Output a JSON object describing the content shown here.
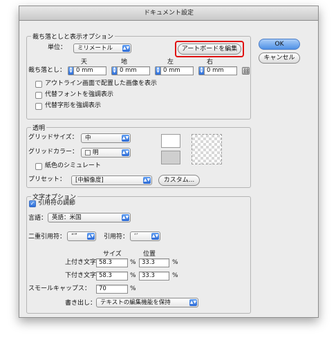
{
  "window": {
    "title": "ドキュメント設定"
  },
  "buttons": {
    "ok": "OK",
    "cancel": "キャンセル"
  },
  "bleed": {
    "legend": "裁ち落としと表示オプション",
    "unit_label": "単位：",
    "unit_value": "ミリメートル",
    "artboard_button": "アートボードを編集",
    "col_top": "天",
    "col_bottom": "地",
    "col_left": "左",
    "col_right": "右",
    "bleed_label": "裁ち落とし：",
    "top": "0 mm",
    "bottom": "0 mm",
    "left": "0 mm",
    "right": "0 mm",
    "cb_outline": "アウトライン画面で配置した画像を表示",
    "cb_font": "代替フォントを強調表示",
    "cb_glyph": "代替字形を強調表示"
  },
  "transparency": {
    "legend": "透明",
    "grid_size_label": "グリッドサイズ：",
    "grid_size_value": "中",
    "grid_color_label": "グリッドカラー：",
    "grid_color_value": "明",
    "cb_paper": "紙色のシミュレート",
    "preset_label": "プリセット：",
    "preset_value": "[中解像度]",
    "custom_button": "カスタム..."
  },
  "text": {
    "legend": "文字オプション",
    "cb_quotes": "引用符の調節",
    "lang_label": "言語：",
    "lang_value": "英語：米国",
    "double_quote_label": "二重引用符：",
    "double_quote_value": "“”",
    "single_quote_label": "引用符：",
    "single_quote_value": "‘’",
    "size_header": "サイズ",
    "position_header": "位置",
    "superscript_label": "上付き文字：",
    "super_size": "58.3",
    "super_pos": "33.3",
    "subscript_label": "下付き文字：",
    "sub_size": "58.3",
    "sub_pos": "33.3",
    "smallcaps_label": "スモールキャップス：",
    "smallcaps_value": "70",
    "pct": "%",
    "export_label": "書き出し：",
    "export_value": "テキストの編集機能を保持"
  },
  "colors": {
    "highlight": "#e01010",
    "accent": "#2f6fd8"
  }
}
